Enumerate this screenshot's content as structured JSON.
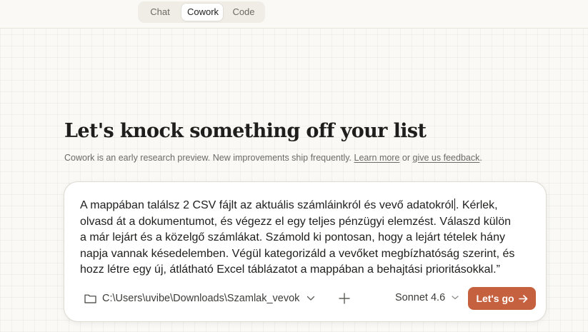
{
  "mode_tabs": [
    {
      "label": "Chat",
      "active": false
    },
    {
      "label": "Cowork",
      "active": true
    },
    {
      "label": "Code",
      "active": false
    }
  ],
  "headline": "Let's knock something off your list",
  "subline": {
    "text": "Cowork is an early research preview. New improvements ship frequently.",
    "learn_more": "Learn more",
    "or": "or",
    "feedback": "give us feedback",
    "period": "."
  },
  "prompt": {
    "line1_before_caret": "A mappában találsz 2 CSV fájlt az aktuális számláinkról és vevő adatokról",
    "line1_after_caret": ". Kérlek,",
    "line2": "olvasd át a dokumentumot, és végezz el egy teljes pénzügyi elemzést. Válaszd külön",
    "line3": "a már lejárt és a közelgő számlákat. Számold ki pontosan, hogy a lejárt tételek hány",
    "line4": "napja vannak késedelemben. Végül kategorizáld a vevőket megbízhatóság szerint, és",
    "line5": "hozz létre egy új, átlátható Excel táblázatot a mappában a behajtási prioritásokkal.”"
  },
  "composer": {
    "folder_path": "C:\\Users\\uvibe\\Downloads\\Szamlak_vevok",
    "model": "Sonnet 4.6",
    "submit_label": "Let's go",
    "icons": [
      "folder-icon",
      "chevron-down-icon",
      "plus-icon",
      "chevron-down-icon",
      "arrow-right-icon"
    ]
  },
  "colors": {
    "background": "#faf9f5",
    "accent": "#c6613f",
    "text": "#1f1e1d",
    "muted": "#6b6a64"
  }
}
